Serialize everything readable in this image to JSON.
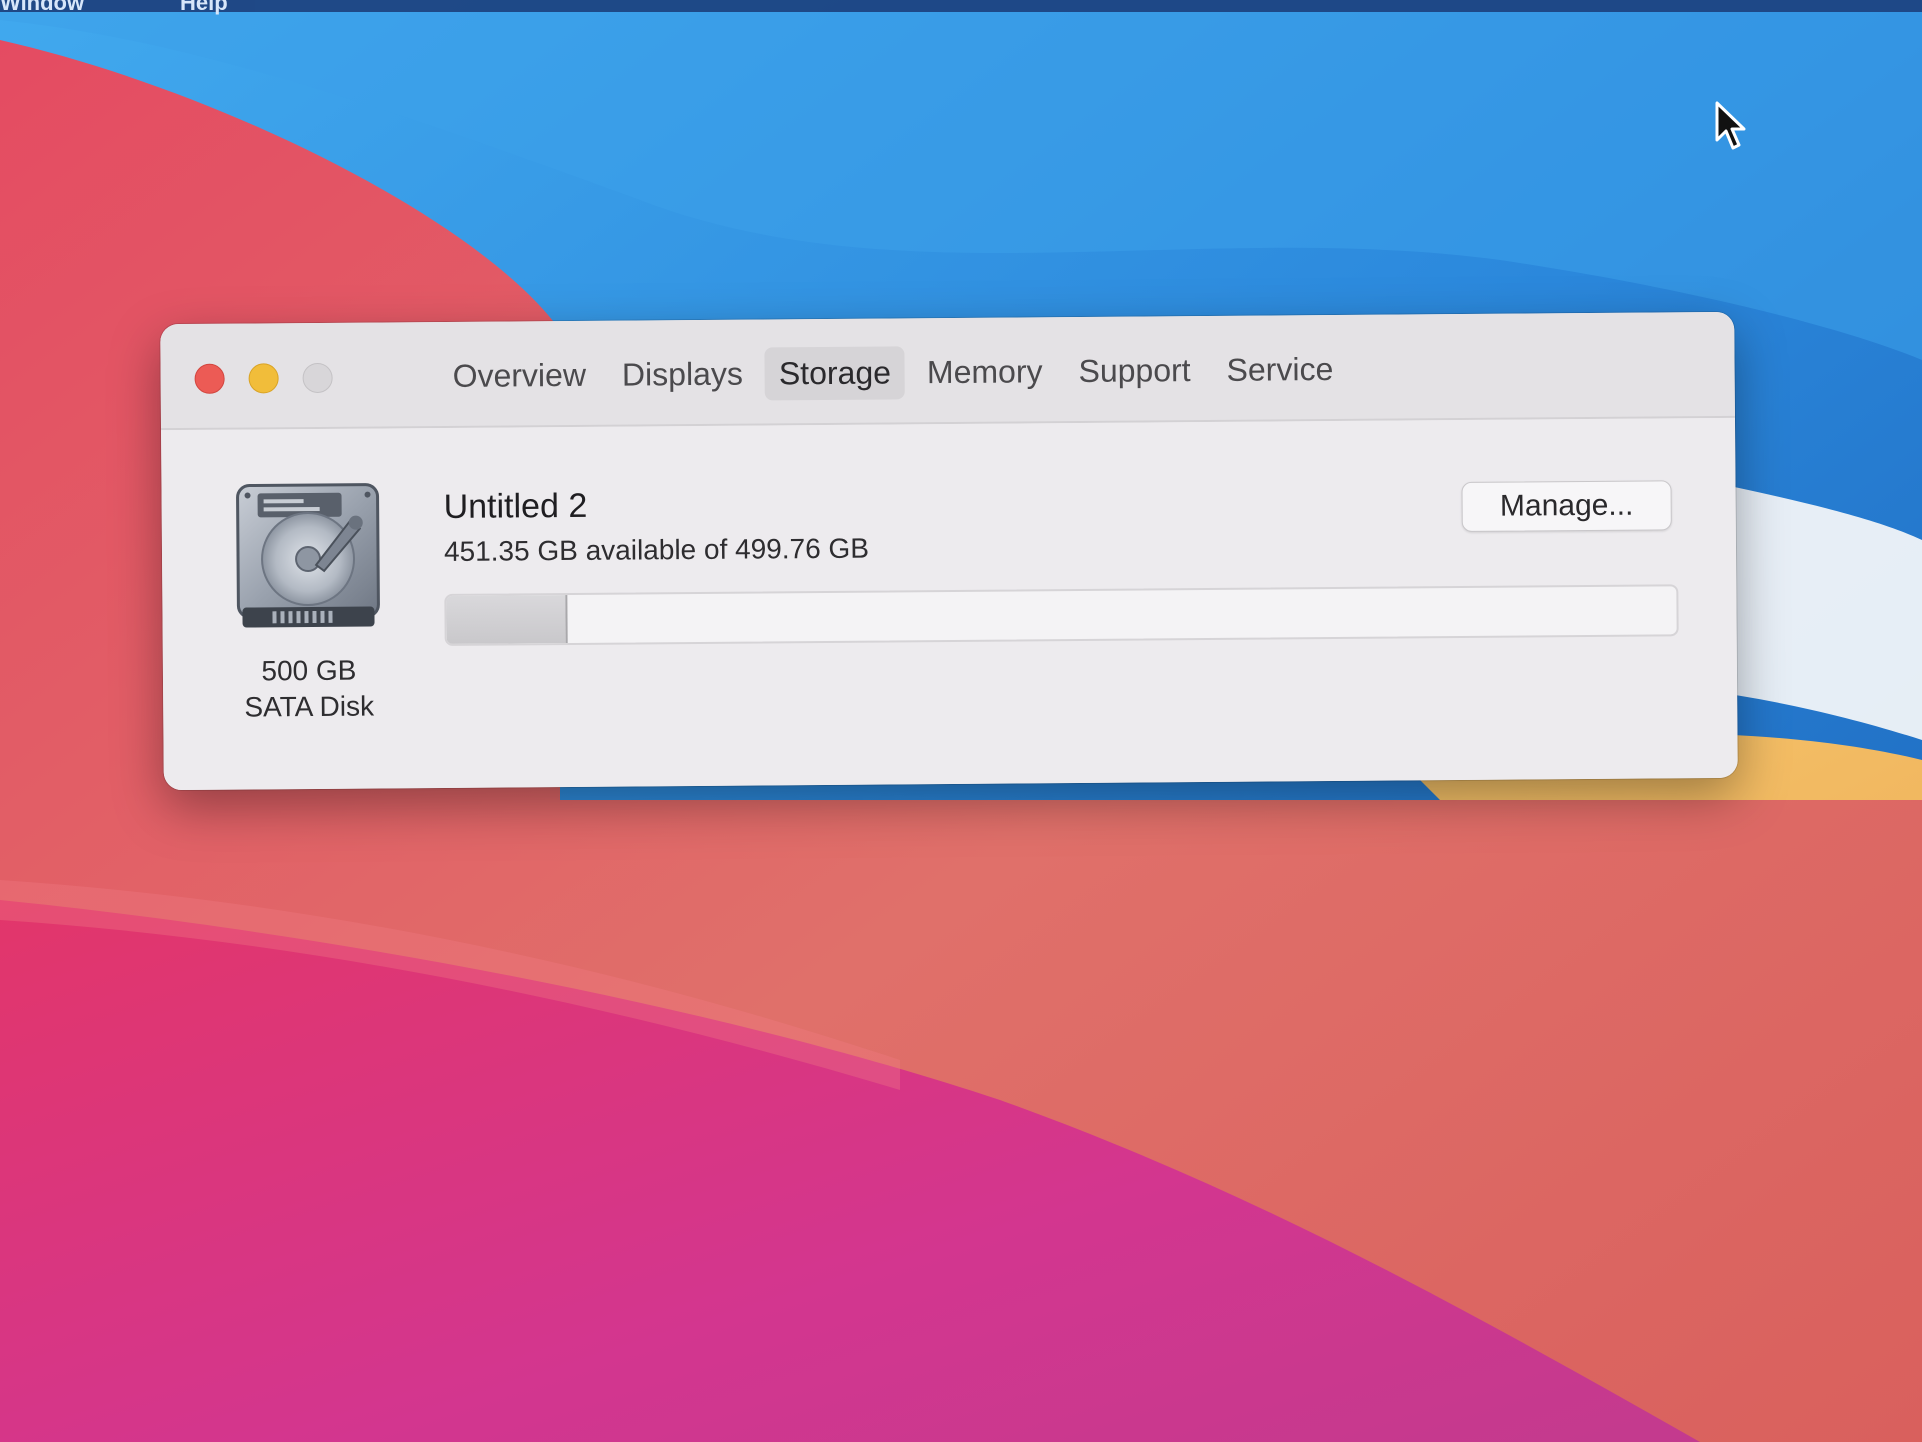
{
  "desktop": {
    "menubar_items": [
      "Window",
      "Help"
    ]
  },
  "window": {
    "tabs": [
      {
        "label": "Overview"
      },
      {
        "label": "Displays"
      },
      {
        "label": "Storage"
      },
      {
        "label": "Memory"
      },
      {
        "label": "Support"
      },
      {
        "label": "Service"
      }
    ],
    "selected_tab": "Storage"
  },
  "storage": {
    "disk": {
      "icon": "hard-drive-icon",
      "size": "500 GB",
      "type": "SATA Disk"
    },
    "volume": {
      "name": "Untitled 2",
      "capacity_text": "451.35 GB available of 499.76 GB",
      "used_fraction": 0.0969
    },
    "manage_label": "Manage..."
  },
  "colors": {
    "close": "#ec5b55",
    "minimize": "#f1bd3a",
    "zoom_disabled": "#d8d6d9",
    "window_bg": "#eceaed"
  }
}
